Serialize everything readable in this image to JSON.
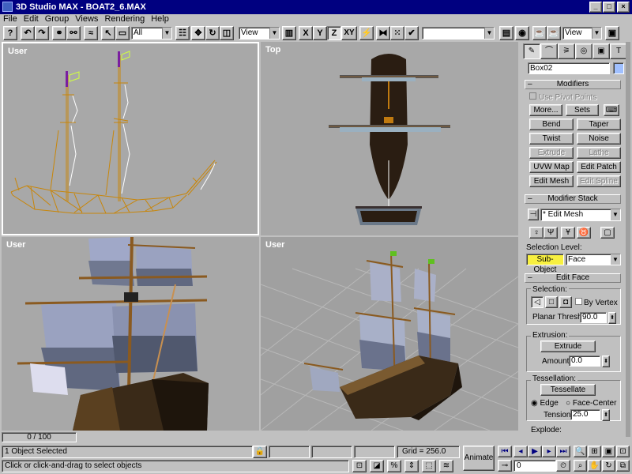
{
  "window": {
    "title": "3D Studio MAX - BOAT2_6.MAX",
    "min": "_",
    "max": "□",
    "close": "×"
  },
  "menu": [
    "File",
    "Edit",
    "Group",
    "Views",
    "Rendering",
    "Help"
  ],
  "toolbar": {
    "selection_filter": "All",
    "ref_coord": "View",
    "axis": [
      "X",
      "Y",
      "Z",
      "XY"
    ],
    "named_sel": "",
    "view_right": "View"
  },
  "viewports": {
    "top_left": "User",
    "top_right": "Top",
    "bottom_left": "User",
    "bottom_right": "User"
  },
  "command_panel": {
    "object_name": "Box02",
    "modifiers": {
      "header": "Modifiers",
      "use_pivot": "Use Pivot Points",
      "more": "More...",
      "sets": "Sets",
      "buttons": [
        "Bend",
        "Taper",
        "Twist",
        "Noise",
        "Extrude",
        "Lathe",
        "UVW Map",
        "Edit Patch",
        "Edit Mesh",
        "Edit Spline"
      ]
    },
    "stack": {
      "header": "Modifier Stack",
      "current": "* Edit Mesh",
      "selection_level": "Selection Level:",
      "subobject": "Sub-Object",
      "level": "Face"
    },
    "edit_face": {
      "header": "Edit Face",
      "selection": "Selection:",
      "by_vertex": "By Vertex",
      "planar": "Planar Thresh:",
      "planar_val": "90.0",
      "extrusion": "Extrusion:",
      "extrude": "Extrude",
      "amount": "Amount:",
      "amount_val": "0.0",
      "tessellation": "Tessellation:",
      "tessellate": "Tessellate",
      "edge": "Edge",
      "face_center": "Face-Center",
      "tension": "Tension:",
      "tension_val": "25.0",
      "explode": "Explode:"
    }
  },
  "status": {
    "frame": "0 / 100",
    "selected": "1 Object Selected",
    "prompt": "Click or click-and-drag to select objects",
    "grid": "Grid = 256.0",
    "animate": "Animate",
    "frame_field": "0"
  }
}
